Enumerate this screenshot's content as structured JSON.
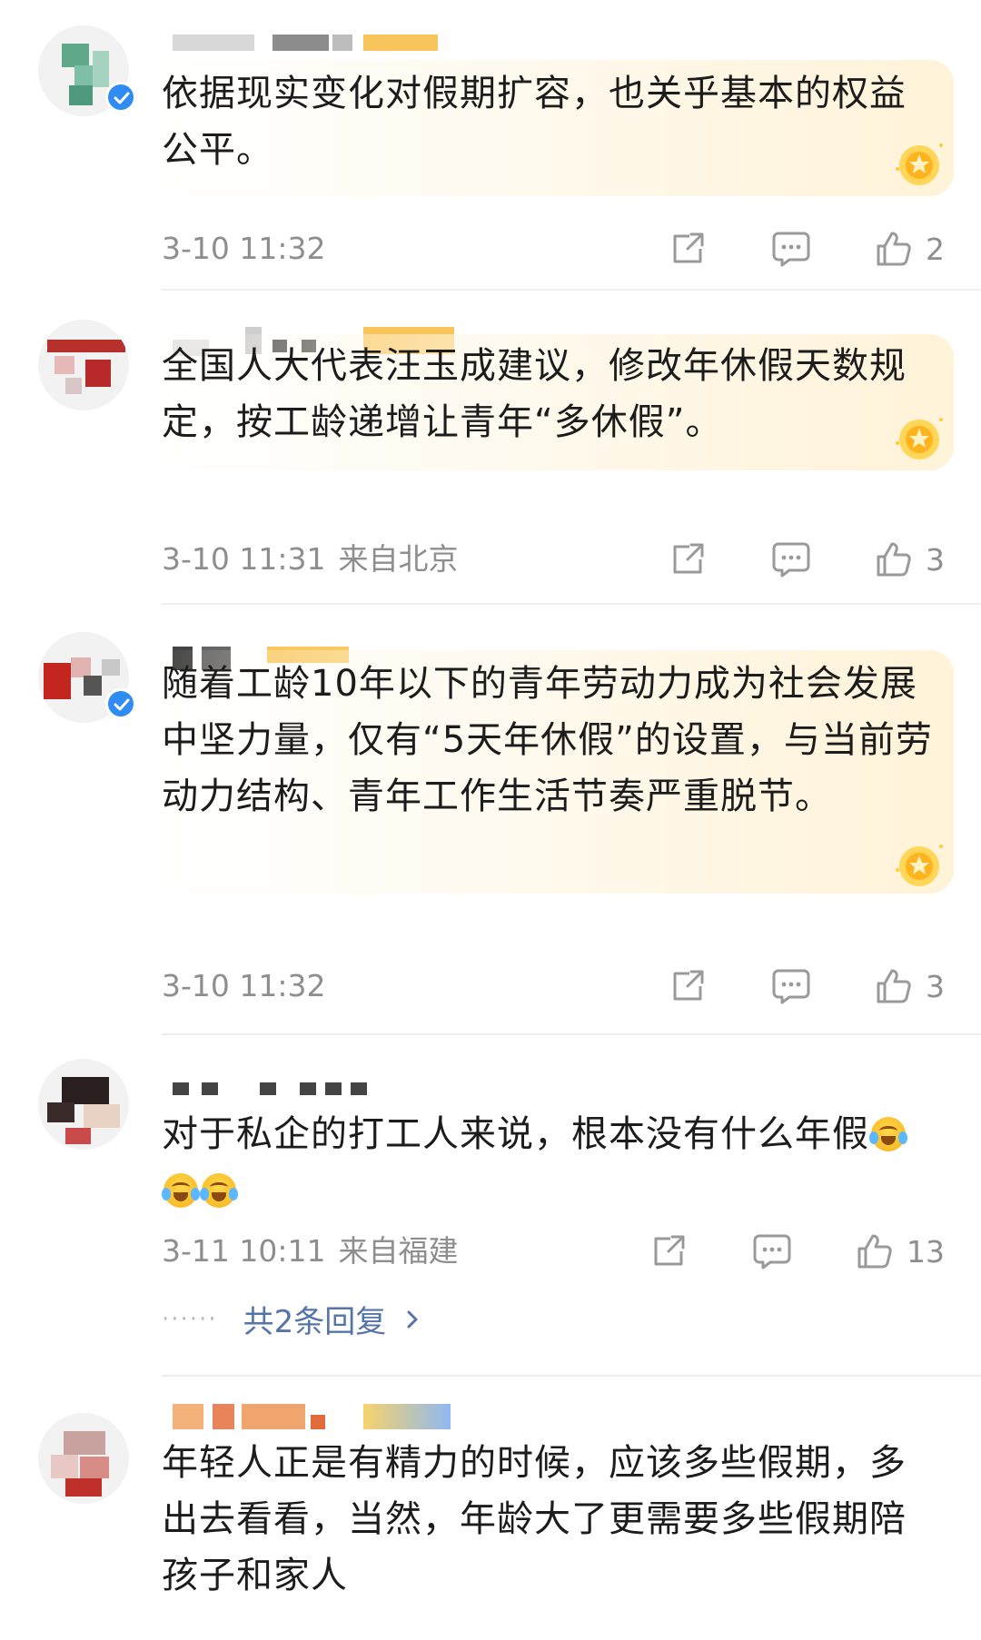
{
  "comments": [
    {
      "text": "依据现实变化对假期扩容，也关乎基本的权益公平。",
      "time": "3-10 11:32",
      "location": "",
      "likes": "2",
      "verified": true
    },
    {
      "text": "全国人大代表汪玉成建议，修改年休假天数规定，按工龄递增让青年“多休假”。",
      "time": "3-10 11:31",
      "location": "来自北京",
      "likes": "3",
      "verified": false
    },
    {
      "text": "随着工龄10年以下的青年劳动力成为社会发展中坚力量，仅有“5天年休假”的设置，与当前劳动力结构、青年工作生活节奏严重脱节。",
      "time": "3-10 11:32",
      "location": "",
      "likes": "3",
      "verified": true
    },
    {
      "text": "对于私企的打工人来说，根本没有什么年假",
      "time": "3-11 10:11",
      "location": "来自福建",
      "likes": "13",
      "verified": false,
      "emojis": [
        "laugh-cry-emoji",
        "laugh-cry-emoji",
        "laugh-cry-emoji"
      ],
      "replies_label": "共2条回复",
      "replies_dots": "······"
    },
    {
      "text": "年轻人正是有精力的时候，应该多些假期，多出去看看，当然，年龄大了更需要多些假期陪孩子和家人",
      "verified": false
    }
  ],
  "icons": {
    "share": "share-icon",
    "comment": "comment-icon",
    "like": "thumb-up-icon",
    "verified": "verified-badge-icon",
    "fan_badge": "star-badge-icon",
    "chevron": "chevron-right-icon"
  },
  "colors": {
    "meta_gray": "#8e8e8e",
    "reply_link": "#5575a8",
    "verified_blue": "#2f8cf5",
    "bubble_gold": "#fff2d6"
  }
}
